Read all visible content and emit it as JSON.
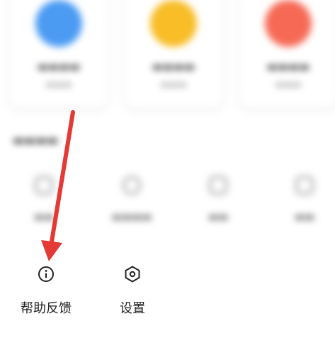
{
  "colors": {
    "card_blue": "#4b9bf3",
    "card_yellow": "#f8bd27",
    "card_red": "#f66a55",
    "arrow_red": "#e53935"
  },
  "bottom": {
    "items": [
      {
        "label": "帮助反馈",
        "icon": "info-circle-icon"
      },
      {
        "label": "设置",
        "icon": "hexagon-settings-icon"
      }
    ]
  },
  "annotation": {
    "type": "red-arrow",
    "points_to": "帮助反馈"
  }
}
